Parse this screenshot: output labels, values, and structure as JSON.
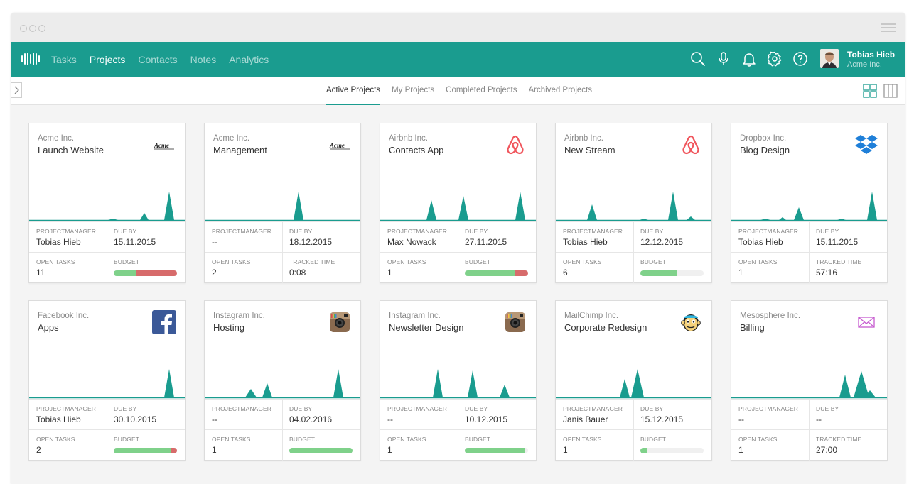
{
  "navbar": {
    "links": [
      "Tasks",
      "Projects",
      "Contacts",
      "Notes",
      "Analytics"
    ],
    "active_index": 1,
    "icons": [
      "search-icon",
      "microphone-icon",
      "bell-icon",
      "gear-icon",
      "help-icon"
    ],
    "user": {
      "name": "Tobias Hieb",
      "company": "Acme Inc."
    },
    "color": "#1a9c8f"
  },
  "subnav": {
    "tabs": [
      "Active Projects",
      "My Projects",
      "Completed Projects",
      "Archived Projects"
    ],
    "active_index": 0,
    "view_icons": [
      "grid-view-icon",
      "columns-view-icon"
    ]
  },
  "labels": {
    "manager": "PROJECTMANAGER",
    "due": "DUE BY",
    "tasks": "OPEN TASKS",
    "budget": "BUDGET",
    "tracked": "TRACKED TIME"
  },
  "projects": [
    {
      "company": "Acme Inc.",
      "name": "Launch Website",
      "logo": "acme",
      "manager": "Tobias Hieb",
      "due": "15.11.2015",
      "tasks": "11",
      "metric": "budget",
      "budget": 0.35,
      "over": 0.65
    },
    {
      "company": "Acme Inc.",
      "name": "Management",
      "logo": "acme",
      "manager": "--",
      "due": "18.12.2015",
      "tasks": "2",
      "metric": "tracked",
      "tracked": "0:08"
    },
    {
      "company": "Airbnb Inc.",
      "name": "Contacts App",
      "logo": "airbnb",
      "manager": "Max Nowack",
      "due": "27.11.2015",
      "tasks": "1",
      "metric": "budget",
      "budget": 0.8,
      "over": 0.2
    },
    {
      "company": "Airbnb Inc.",
      "name": "New Stream",
      "logo": "airbnb",
      "manager": "Tobias Hieb",
      "due": "12.12.2015",
      "tasks": "6",
      "metric": "budget",
      "budget": 0.58,
      "over": 0
    },
    {
      "company": "Dropbox Inc.",
      "name": "Blog Design",
      "logo": "dropbox",
      "manager": "Tobias Hieb",
      "due": "15.11.2015",
      "tasks": "1",
      "metric": "tracked",
      "tracked": "57:16"
    },
    {
      "company": "Facebook Inc.",
      "name": "Apps",
      "logo": "facebook",
      "manager": "Tobias Hieb",
      "due": "30.10.2015",
      "tasks": "2",
      "metric": "budget",
      "budget": 0.9,
      "over": 0.1
    },
    {
      "company": "Instagram Inc.",
      "name": "Hosting",
      "logo": "instagram",
      "manager": "--",
      "due": "04.02.2016",
      "tasks": "1",
      "metric": "budget",
      "budget": 1.0,
      "over": 0
    },
    {
      "company": "Instagram Inc.",
      "name": "Newsletter Design",
      "logo": "instagram",
      "manager": "--",
      "due": "10.12.2015",
      "tasks": "1",
      "metric": "budget",
      "budget": 0.96,
      "over": 0
    },
    {
      "company": "MailChimp Inc.",
      "name": "Corporate Redesign",
      "logo": "mailchimp",
      "manager": "Janis Bauer",
      "due": "15.12.2015",
      "tasks": "1",
      "metric": "budget",
      "budget": 0.1,
      "over": 0
    },
    {
      "company": "Mesosphere Inc.",
      "name": "Billing",
      "logo": "mesosphere",
      "manager": "--",
      "due": "--",
      "tasks": "1",
      "metric": "tracked",
      "tracked": "27:00"
    }
  ]
}
